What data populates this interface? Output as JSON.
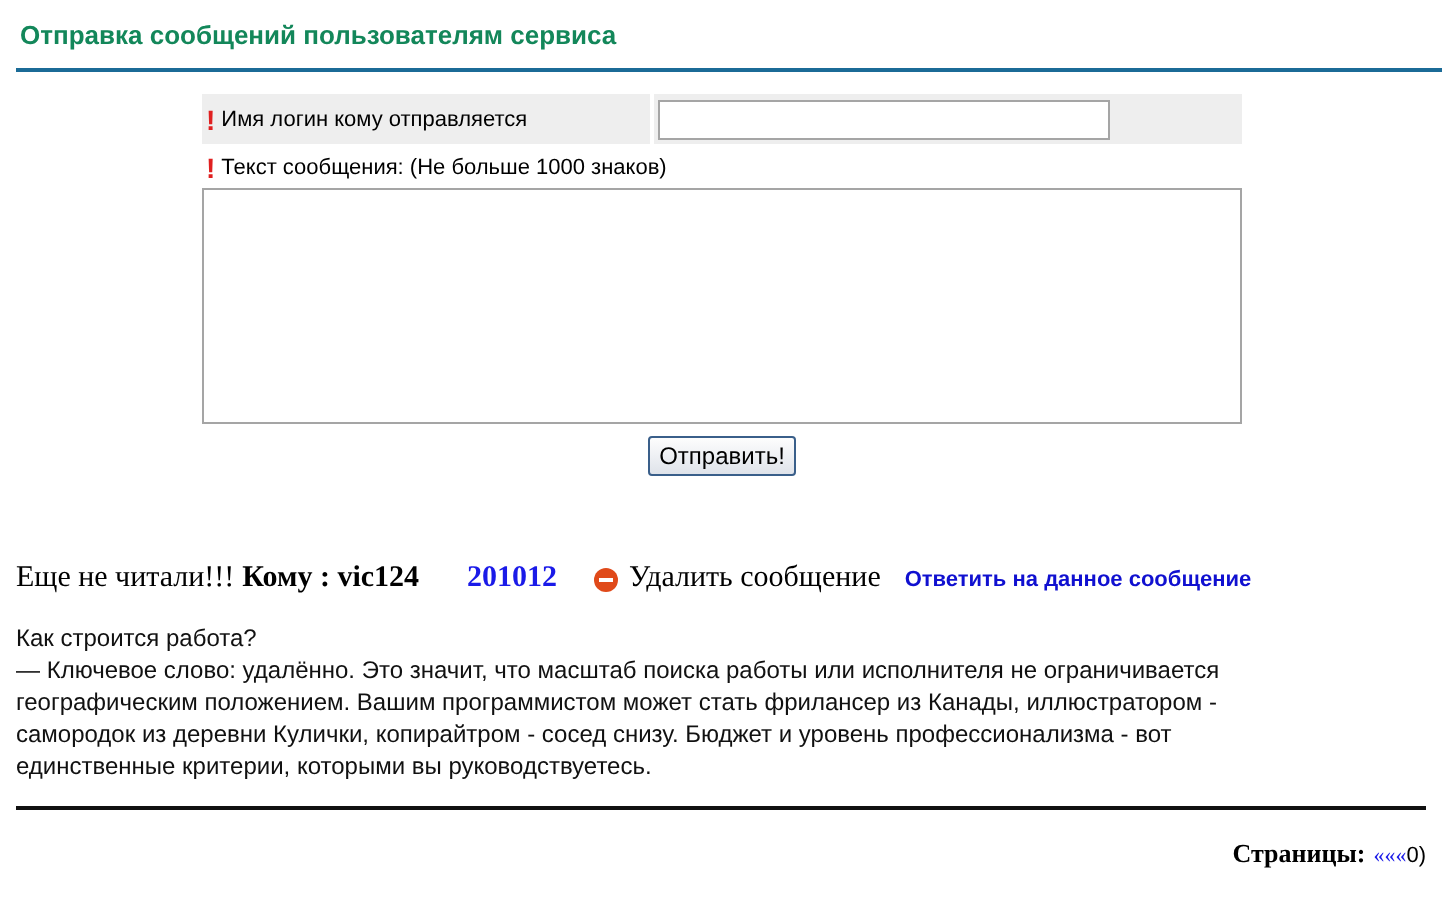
{
  "title": "Отправка сообщений пользователям сервиса",
  "form": {
    "recipient_label": "Имя логин кому отправляется",
    "required_mark": "!",
    "message_label": "Текст сообщения: (Не больше 1000 знаков)",
    "message_required_mark": "!",
    "submit": "Отправить!"
  },
  "message": {
    "status": "Еще не читали!!!",
    "to": "Кому : vic124",
    "id": "201012",
    "delete": "Удалить сообщение",
    "reply": "Ответить на данное сообщение",
    "question": "Как строится работа?",
    "body": "— Ключевое слово: удалённо. Это значит, что масштаб поиска работы или исполнителя не ограничивается географическим положением. Вашим программистом может стать фрилансер из Канады, иллюстратором - самородок из деревни Кулички, копирайтром - сосед снизу. Бюджет и уровень профессионализма - вот единственные критерии, которыми вы руководствуетесь."
  },
  "pagination": {
    "label": "Страницы:",
    "link": "«««",
    "current": "0)"
  }
}
